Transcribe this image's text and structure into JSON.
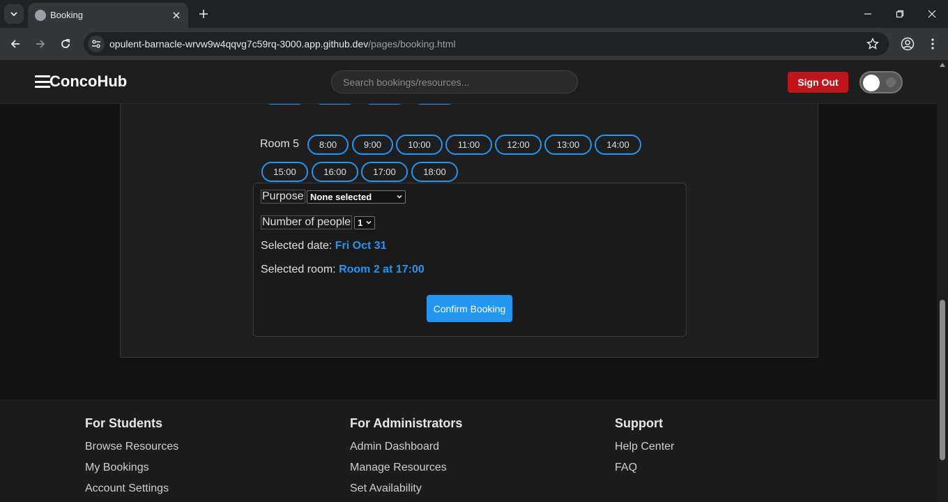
{
  "browser": {
    "tab_title": "Booking",
    "url_host": "opulent-barnacle-wrvw9w4qqvg7c59rq-3000.app.github.dev",
    "url_path": "/pages/booking.html"
  },
  "header": {
    "brand": "ConcoHub",
    "search_placeholder": "Search bookings/resources...",
    "sign_out_label": "Sign Out"
  },
  "schedule": {
    "partial_row_slots": [
      "",
      "",
      "",
      ""
    ],
    "room_label": "Room 5",
    "slots": [
      "8:00",
      "9:00",
      "10:00",
      "11:00",
      "12:00",
      "13:00",
      "14:00",
      "15:00",
      "16:00",
      "17:00",
      "18:00"
    ]
  },
  "booking": {
    "purpose_label": "Purpose",
    "purpose_value": "None selected",
    "people_label": "Number of people",
    "people_value": "1",
    "date_label": "Selected date:",
    "date_value": "Fri Oct 31",
    "room_label": "Selected room:",
    "room_value": "Room 2 at 17:00",
    "confirm_label": "Confirm Booking"
  },
  "footer": {
    "students": {
      "title": "For Students",
      "links": [
        "Browse Resources",
        "My Bookings",
        "Account Settings"
      ]
    },
    "admins": {
      "title": "For Administrators",
      "links": [
        "Admin Dashboard",
        "Manage Resources",
        "Set Availability"
      ]
    },
    "support": {
      "title": "Support",
      "links": [
        "Help Center",
        "FAQ"
      ]
    }
  },
  "colors": {
    "accent": "#2196f3",
    "danger": "#c0161b",
    "background": "#121212"
  }
}
